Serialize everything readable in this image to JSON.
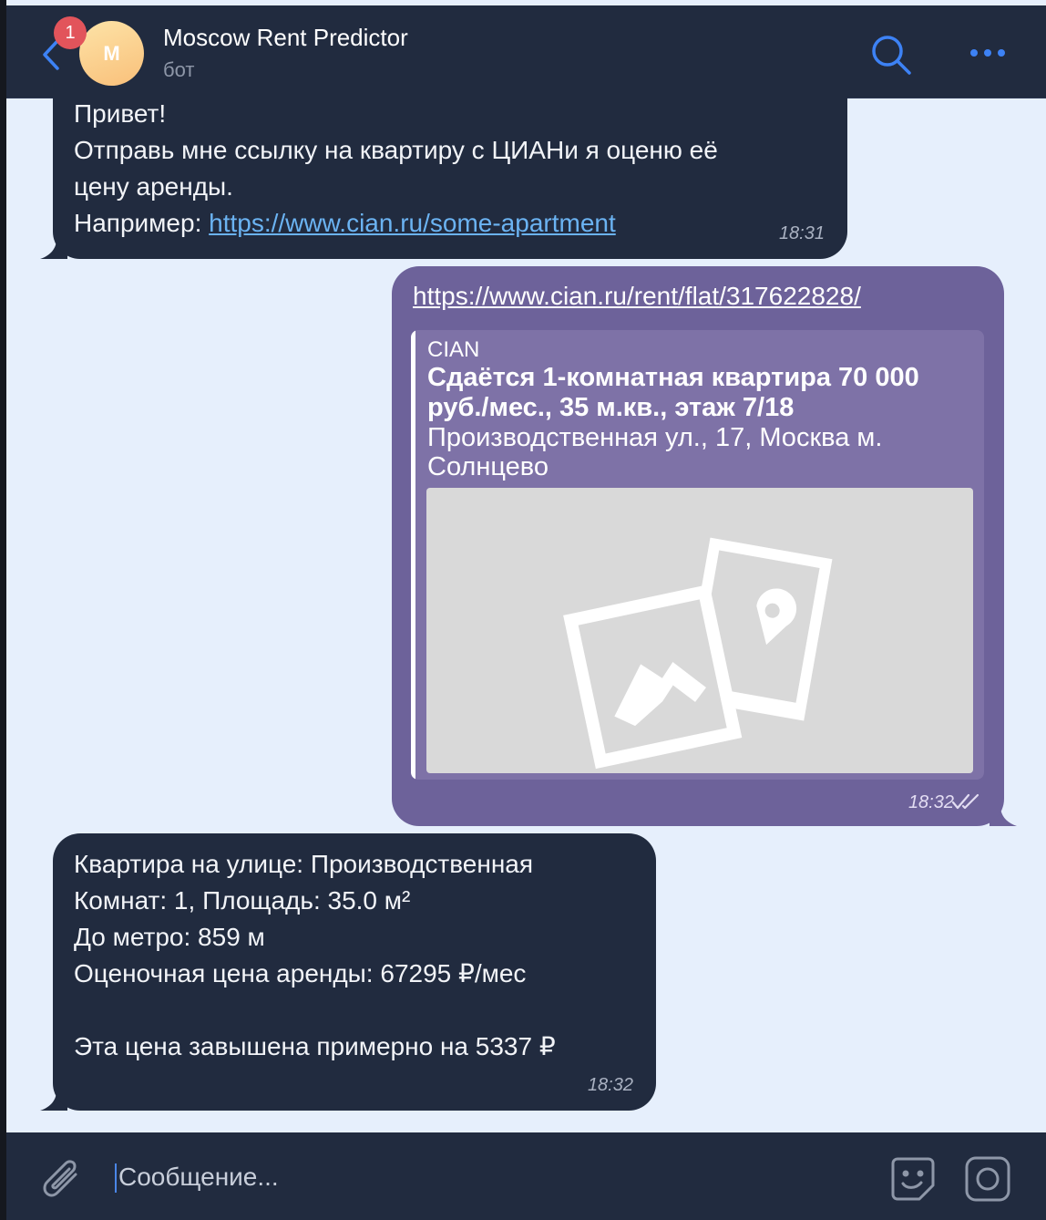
{
  "header": {
    "unread_badge": "1",
    "avatar_letter": "M",
    "title": "Moscow Rent Predictor",
    "subtitle": "бот",
    "accent_color": "#3d82f5"
  },
  "messages": [
    {
      "direction": "incoming",
      "text": "Привет!\nОтправь мне ссылку на квартиру с ЦИАНи я оценю её\nцену аренды.\nНапример: ",
      "link": "https://www.cian.ru/some-apartment",
      "time": "18:31"
    },
    {
      "direction": "outgoing",
      "url": "https://www.cian.ru/rent/flat/317622828/",
      "preview": {
        "site": "CIAN",
        "title": "Сдаётся 1-комнатная квартира 70 000 руб./мес., 35 м.кв., этаж 7/18",
        "description": "Производственная ул., 17, Москва м. Солнцево",
        "image_icon": "image-placeholder-icon"
      },
      "time": "18:32",
      "status_icon": "double-check-icon"
    },
    {
      "direction": "incoming",
      "text": "Квартира на улице: Производственная\nКомнат: 1, Площадь: 35.0 м²\nДо метро: 859 м\nОценочная цена аренды: 67295 ₽/мес\n\nЭта цена завышена примерно на 5337 ₽",
      "time": "18:32"
    }
  ],
  "composer": {
    "placeholder": "Сообщение...",
    "icons": [
      "paperclip-icon",
      "sticker-icon",
      "camera-icon"
    ]
  },
  "colors": {
    "header_bg": "#212b3f",
    "incoming_bubble": "#212b3f",
    "outgoing_bubble": "#6d629a",
    "chat_background": "#e6effc",
    "badge": "#e2545b"
  }
}
